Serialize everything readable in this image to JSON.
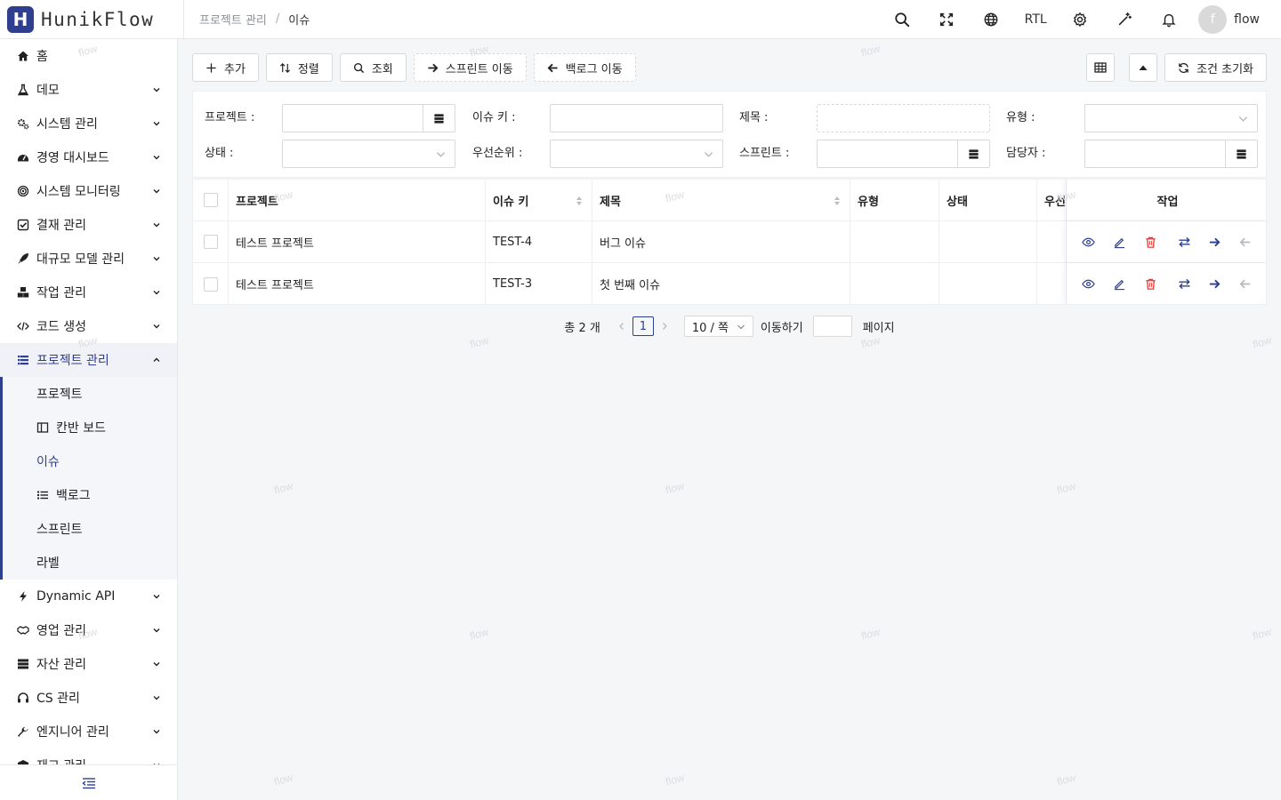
{
  "app": {
    "logo_mark": "H",
    "name": "HunikFlow"
  },
  "breadcrumb": {
    "parent": "프로젝트 관리",
    "separator": "/",
    "current": "이슈"
  },
  "header": {
    "rtl_label": "RTL",
    "user_initial": "f",
    "user_name": "flow"
  },
  "sidebar": {
    "items": [
      {
        "label": "홈",
        "icon": "home-icon"
      },
      {
        "label": "데모",
        "icon": "flask-icon"
      },
      {
        "label": "시스템 관리",
        "icon": "gears-icon"
      },
      {
        "label": "경영 대시보드",
        "icon": "gauge-icon"
      },
      {
        "label": "시스템 모니터링",
        "icon": "target-icon"
      },
      {
        "label": "결재 관리",
        "icon": "checkbox-icon"
      },
      {
        "label": "대규모 모델 관리",
        "icon": "rocket-icon"
      },
      {
        "label": "작업 관리",
        "icon": "cubes-icon"
      },
      {
        "label": "코드 생성",
        "icon": "code-icon"
      },
      {
        "label": "프로젝트 관리",
        "icon": "list-icon"
      }
    ],
    "sub_items": [
      {
        "label": "프로젝트",
        "icon": ""
      },
      {
        "label": "칸반 보드",
        "icon": "columns-icon"
      },
      {
        "label": "이슈",
        "icon": ""
      },
      {
        "label": "백로그",
        "icon": "list-ul-icon"
      },
      {
        "label": "스프린트",
        "icon": ""
      },
      {
        "label": "라벨",
        "icon": ""
      }
    ],
    "items_after": [
      {
        "label": "Dynamic API",
        "icon": "bolt-icon"
      },
      {
        "label": "영업 관리",
        "icon": "handshake-icon"
      },
      {
        "label": "자산 관리",
        "icon": "server-icon"
      },
      {
        "label": "CS 관리",
        "icon": "headset-icon"
      },
      {
        "label": "엔지니어 관리",
        "icon": "wrench-icon"
      },
      {
        "label": "재고 관리",
        "icon": "box-icon"
      }
    ]
  },
  "toolbar": {
    "add": "추가",
    "sort": "정렬",
    "search": "조회",
    "move_sprint": "스프린트 이동",
    "move_backlog": "백로그 이동",
    "reset": "조건 초기화"
  },
  "filters": {
    "project": "프로젝트 :",
    "issue_key": "이슈 키 :",
    "title": "제목 :",
    "type": "유형 :",
    "status": "상태 :",
    "priority": "우선순위 :",
    "sprint": "스프린트 :",
    "assignee": "담당자 :"
  },
  "table": {
    "columns": [
      "프로젝트",
      "이슈 키",
      "제목",
      "유형",
      "상태",
      "우선",
      "작업"
    ],
    "rows": [
      {
        "project": "테스트 프로젝트",
        "key": "TEST-4",
        "title": "버그 이슈",
        "type": "",
        "status": ""
      },
      {
        "project": "테스트 프로젝트",
        "key": "TEST-3",
        "title": "첫 번째 이슈",
        "type": "",
        "status": ""
      }
    ]
  },
  "pager": {
    "total": "총 2 개",
    "current_page": "1",
    "page_size": "10 / 쪽",
    "jump_label": "이동하기",
    "page_label": "페이지"
  },
  "watermark": "flow",
  "colors": {
    "primary": "#2f3f8f",
    "danger": "#e53935",
    "border": "#d9d9d9"
  }
}
